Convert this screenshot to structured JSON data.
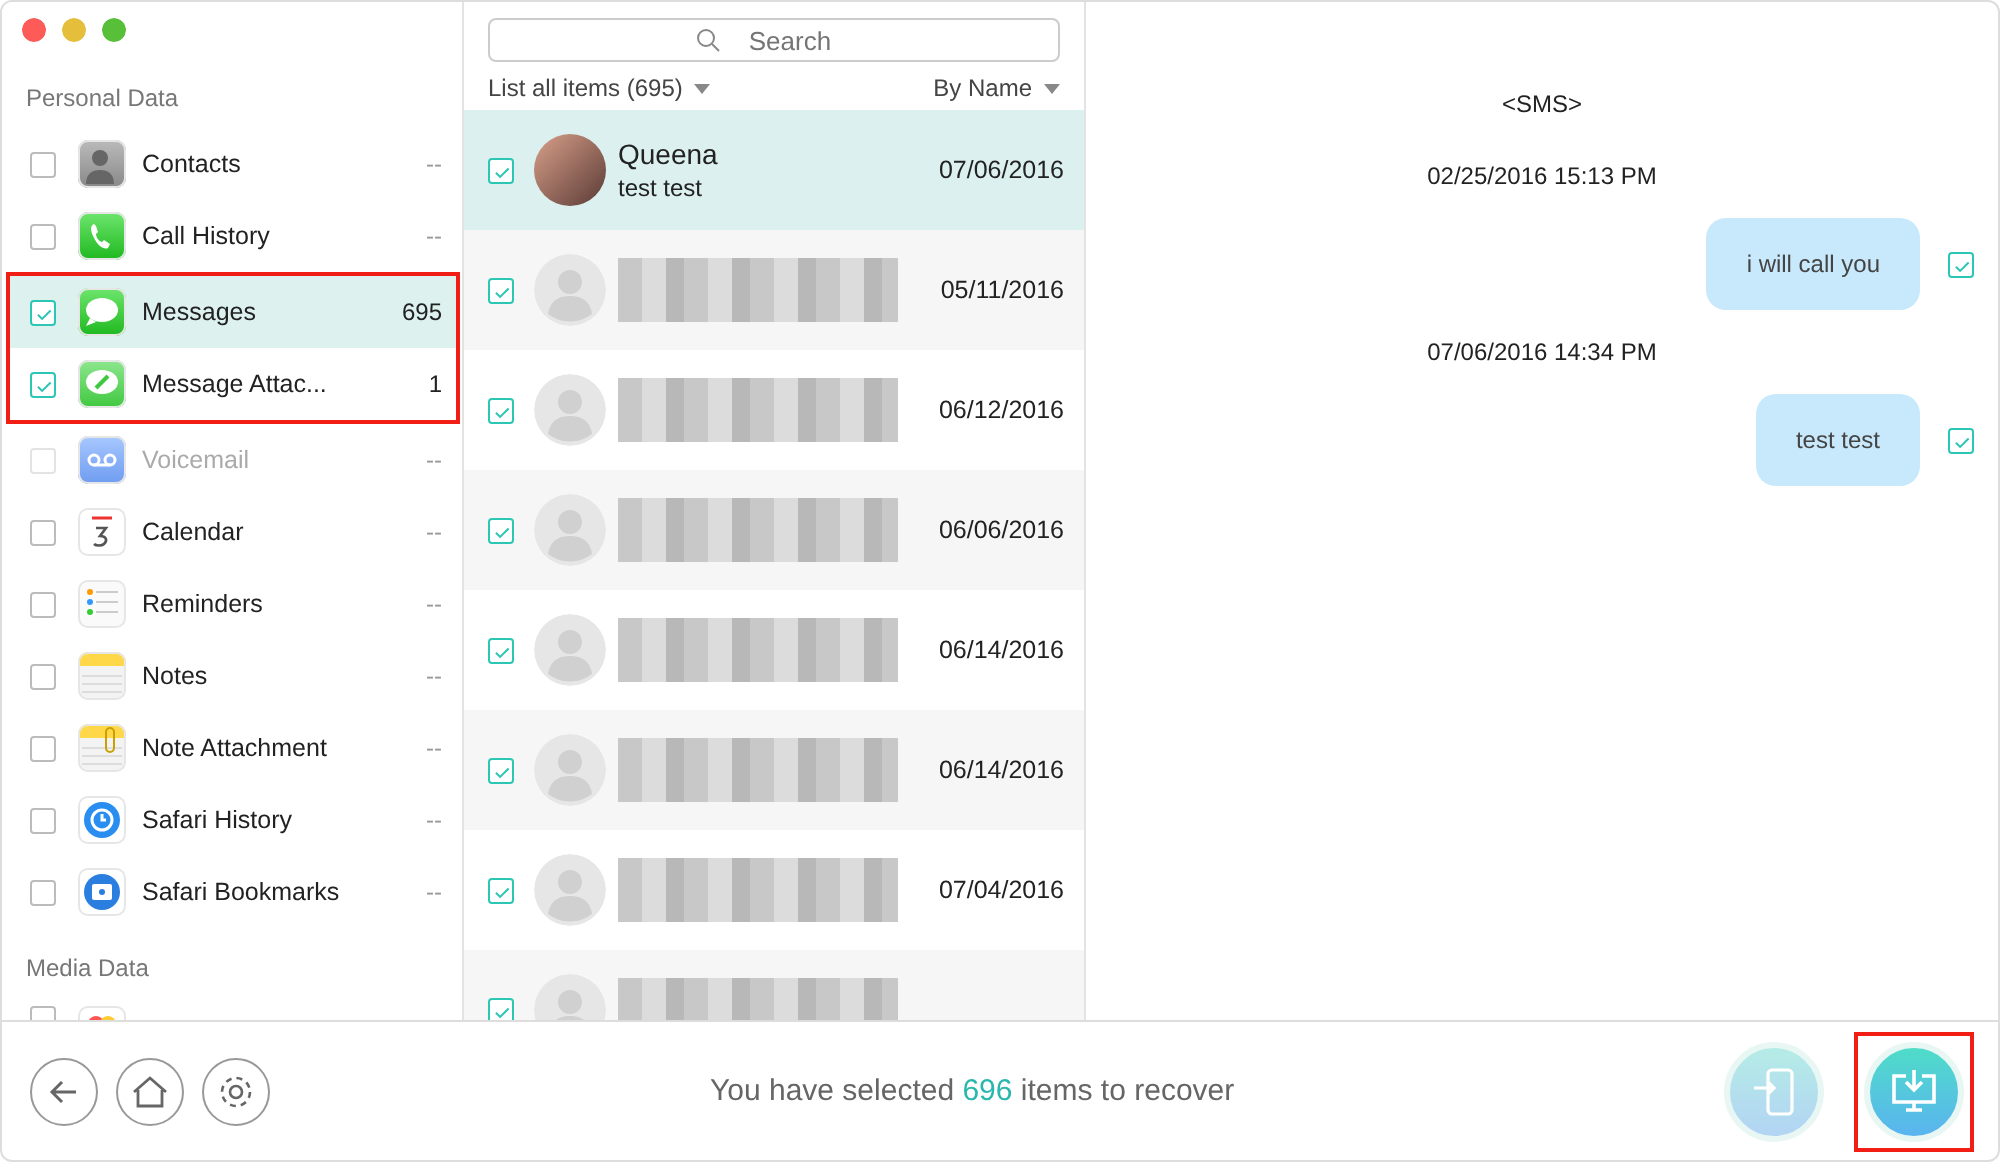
{
  "sidebar": {
    "sections": [
      {
        "title": "Personal Data",
        "items": [
          {
            "kind": "contacts",
            "label": "Contacts",
            "count": "--",
            "checked": false,
            "disabled": false,
            "selected": false,
            "marked": false
          },
          {
            "kind": "phone",
            "label": "Call History",
            "count": "--",
            "checked": false,
            "disabled": false,
            "selected": false,
            "marked": false
          },
          {
            "kind": "messages",
            "label": "Messages",
            "count": "695",
            "checked": true,
            "disabled": false,
            "selected": true,
            "marked": true
          },
          {
            "kind": "attachments",
            "label": "Message Attac...",
            "count": "1",
            "checked": true,
            "disabled": false,
            "selected": false,
            "marked": true
          },
          {
            "kind": "voicemail",
            "label": "Voicemail",
            "count": "--",
            "checked": false,
            "disabled": true,
            "selected": false,
            "marked": false
          },
          {
            "kind": "calendar",
            "label": "Calendar",
            "count": "--",
            "checked": false,
            "disabled": false,
            "selected": false,
            "marked": false
          },
          {
            "kind": "reminders",
            "label": "Reminders",
            "count": "--",
            "checked": false,
            "disabled": false,
            "selected": false,
            "marked": false
          },
          {
            "kind": "notes",
            "label": "Notes",
            "count": "--",
            "checked": false,
            "disabled": false,
            "selected": false,
            "marked": false
          },
          {
            "kind": "note_attachment",
            "label": "Note Attachment",
            "count": "--",
            "checked": false,
            "disabled": false,
            "selected": false,
            "marked": false
          },
          {
            "kind": "safari_history",
            "label": "Safari History",
            "count": "--",
            "checked": false,
            "disabled": false,
            "selected": false,
            "marked": false
          },
          {
            "kind": "safari_bookmarks",
            "label": "Safari Bookmarks",
            "count": "--",
            "checked": false,
            "disabled": false,
            "selected": false,
            "marked": false
          }
        ]
      },
      {
        "title": "Media Data",
        "items": [
          {
            "kind": "photos",
            "checked": false,
            "disabled": false,
            "selected": false,
            "marked": false
          }
        ]
      }
    ]
  },
  "list": {
    "search": {
      "placeholder": "Search"
    },
    "filter": "List all items (695)",
    "sort": "By Name",
    "rows": [
      {
        "name": "Queena",
        "preview": "test test",
        "date": "07/06/2016",
        "kind": "photo",
        "checked": true,
        "selected": true
      },
      {
        "date": "05/11/2016",
        "kind": "silhouette",
        "checked": true,
        "selected": false
      },
      {
        "date": "06/12/2016",
        "kind": "silhouette",
        "checked": true,
        "selected": false
      },
      {
        "date": "06/06/2016",
        "kind": "silhouette",
        "checked": true,
        "selected": false
      },
      {
        "date": "06/14/2016",
        "kind": "silhouette",
        "checked": true,
        "selected": false
      },
      {
        "date": "06/14/2016",
        "kind": "silhouette",
        "checked": true,
        "selected": false
      },
      {
        "date": "07/04/2016",
        "kind": "silhouette",
        "checked": true,
        "selected": false
      },
      {
        "kind": "silhouette",
        "checked": true,
        "selected": false
      }
    ]
  },
  "conversation": {
    "title": "<SMS>",
    "entries": [
      {
        "kind": "timestamp",
        "text": "02/25/2016 15:13 PM"
      },
      {
        "kind": "message",
        "text": "i will call you",
        "checked": true
      },
      {
        "kind": "timestamp",
        "text": "07/06/2016 14:34 PM"
      },
      {
        "kind": "message",
        "text": "test test",
        "checked": true
      }
    ]
  },
  "footer": {
    "nav": [
      {
        "kind": "back"
      },
      {
        "kind": "home"
      },
      {
        "kind": "settings"
      }
    ],
    "status": {
      "before": "You have selected",
      "count": "696",
      "after": "items to recover"
    },
    "actions": [
      {
        "kind": "to_device",
        "marked": false
      },
      {
        "kind": "to_computer",
        "marked": true
      }
    ]
  }
}
